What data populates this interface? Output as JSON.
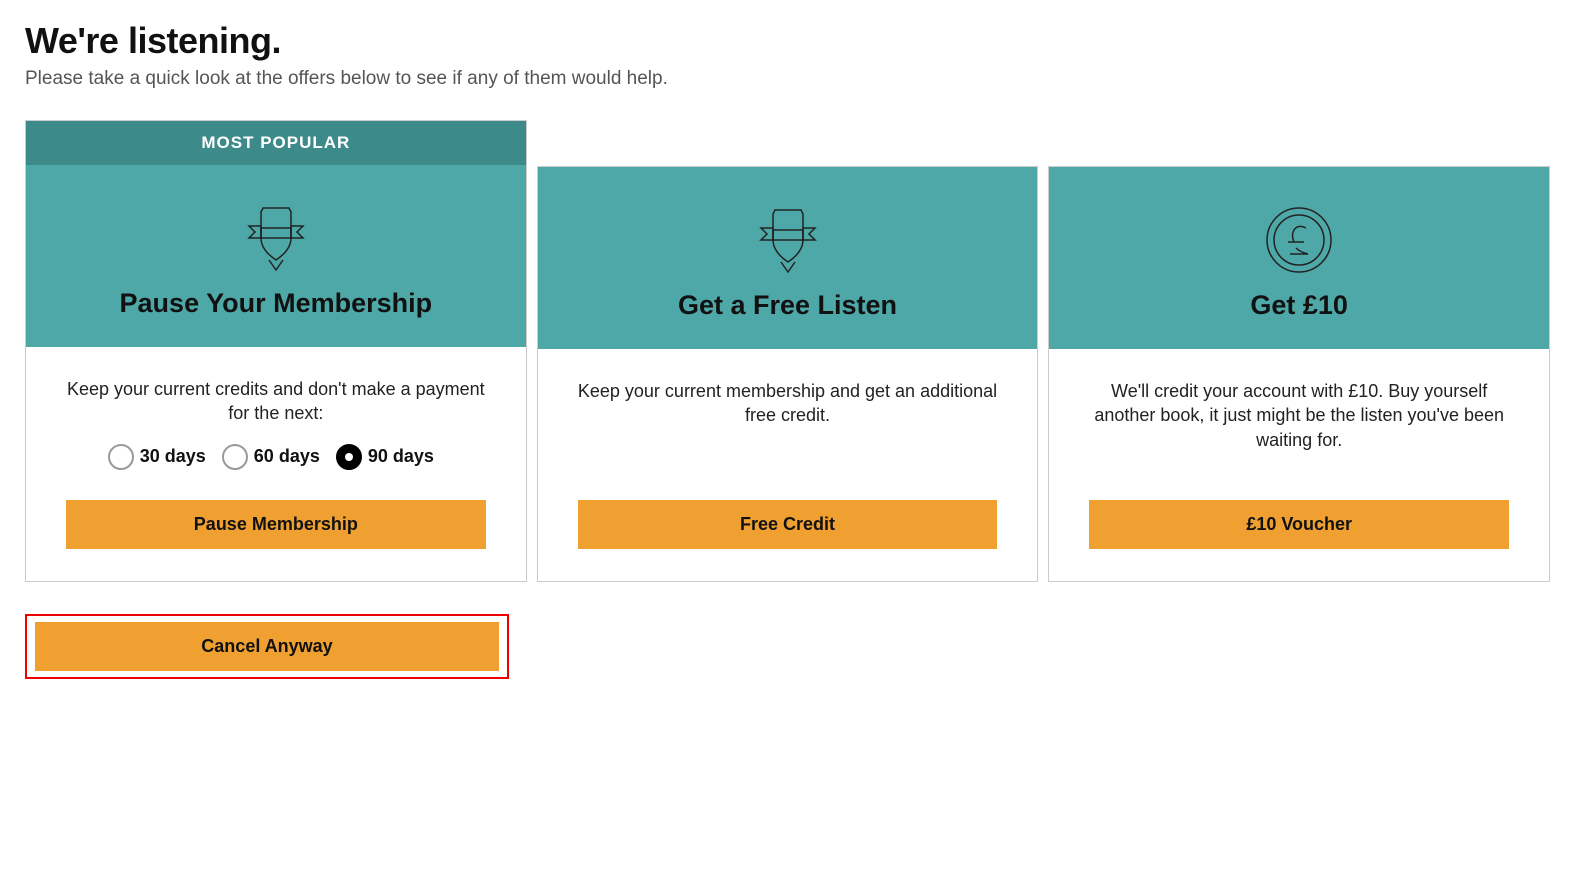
{
  "header": {
    "title": "We're listening.",
    "subtitle": "Please take a quick look at the offers below to see if any of them would help."
  },
  "cards": {
    "pause": {
      "badge": "MOST POPULAR",
      "title": "Pause Your Membership",
      "description": "Keep your current credits and don't make a payment for the next:",
      "options": {
        "opt1": "30 days",
        "opt2": "60 days",
        "opt3": "90 days"
      },
      "selected": "90 days",
      "cta": "Pause Membership"
    },
    "free": {
      "title": "Get a Free Listen",
      "description": "Keep your current membership and get an additional free credit.",
      "cta": "Free Credit"
    },
    "voucher": {
      "title": "Get £10",
      "description": "We'll credit your account with £10. Buy yourself another book, it just might be the listen you've been waiting for.",
      "cta": "£10 Voucher"
    }
  },
  "cancel": {
    "label": "Cancel Anyway"
  }
}
